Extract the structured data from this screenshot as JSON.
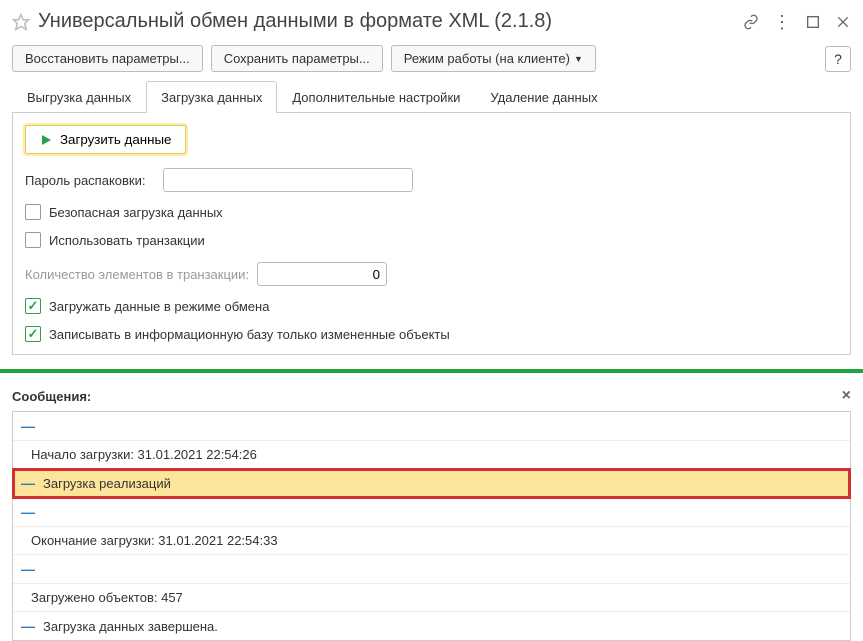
{
  "title": "Универсальный обмен данными в формате XML (2.1.8)",
  "toolbar": {
    "restore": "Восстановить параметры...",
    "save": "Сохранить параметры...",
    "mode": "Режим работы (на клиенте)",
    "help": "?"
  },
  "tabs": {
    "export": "Выгрузка данных",
    "import": "Загрузка данных",
    "additional": "Дополнительные настройки",
    "delete": "Удаление данных"
  },
  "import_tab": {
    "load_button": "Загрузить данные",
    "password_label": "Пароль распаковки:",
    "password_value": "",
    "safe_load": "Безопасная загрузка данных",
    "use_transactions": "Использовать транзакции",
    "tx_count_label": "Количество элементов в транзакции:",
    "tx_count_value": "0",
    "exchange_mode": "Загружать данные в режиме обмена",
    "write_changed_only": "Записывать в информационную базу только измененные объекты"
  },
  "messages": {
    "title": "Сообщения:",
    "items": [
      {
        "text": "Начало загрузки: 31.01.2021 22:54:26",
        "indent": true
      },
      {
        "text": "Загрузка реализаций",
        "highlighted": true,
        "boxed": true
      },
      {
        "text": "Окончание загрузки: 31.01.2021 22:54:33",
        "indent": true
      },
      {
        "text": "Загружено объектов: 457",
        "indent": true
      },
      {
        "text": "Загрузка данных завершена."
      }
    ]
  }
}
